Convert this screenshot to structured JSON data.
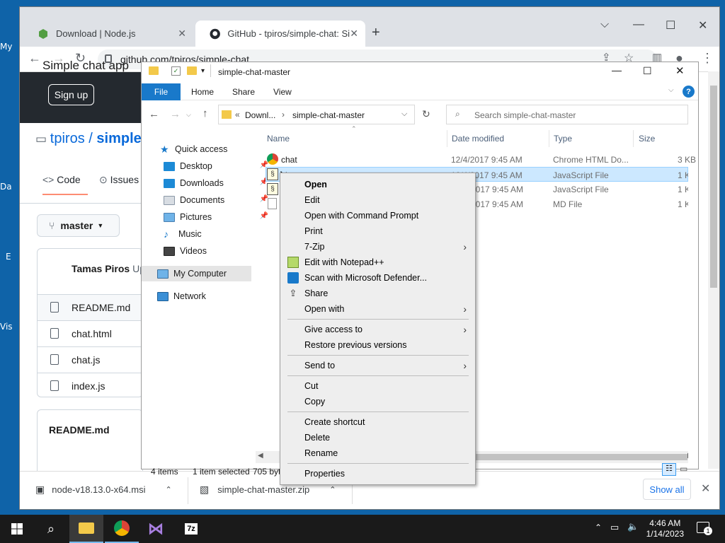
{
  "desktop": {
    "labels": [
      "My",
      "Da",
      "E",
      "Vis"
    ]
  },
  "chrome": {
    "tabs": [
      {
        "title": "Download | Node.js"
      },
      {
        "title": "GitHub - tpiros/simple-chat: Simp"
      }
    ],
    "new_tab": "+",
    "url": "github.com/tpiros/simple-chat"
  },
  "github": {
    "sign_up": "Sign up",
    "owner": "tpiros",
    "sep": "/",
    "repo": "simple",
    "tab_code": "Code",
    "tab_issues": "Issues",
    "branch": "master",
    "commit_author": "Tamas Piros",
    "commit_suffix": "Up",
    "files": [
      "README.md",
      "chat.html",
      "chat.js",
      "index.js"
    ],
    "readme_title": "README.md",
    "readme_body": "Simple chat app"
  },
  "explorer": {
    "title": "simple-chat-master",
    "ribbon": {
      "file": "File",
      "home": "Home",
      "share": "Share",
      "view": "View",
      "help": "?"
    },
    "address": {
      "prefix": "«",
      "crumb1": "Downl...",
      "crumb2": "simple-chat-master"
    },
    "search_placeholder": "Search simple-chat-master",
    "nav": {
      "quick_access": "Quick access",
      "items": [
        "Desktop",
        "Downloads",
        "Documents",
        "Pictures",
        "Music",
        "Videos"
      ],
      "my_computer": "My Computer",
      "network": "Network"
    },
    "columns": {
      "name": "Name",
      "date": "Date modified",
      "type": "Type",
      "size": "Size"
    },
    "rows": [
      {
        "name": "chat",
        "date": "12/4/2017 9:45 AM",
        "type": "Chrome HTML Do...",
        "size": "3 KB"
      },
      {
        "name": "chat",
        "date": "12/4/2017 9:45 AM",
        "type": "JavaScript File",
        "size": "1 KB"
      },
      {
        "name": "",
        "date": "2017 9:45 AM",
        "type": "JavaScript File",
        "size": "1 KB"
      },
      {
        "name": "",
        "date": "2017 9:45 AM",
        "type": "MD File",
        "size": "1 KB"
      }
    ],
    "status": {
      "items": "4 items",
      "selected": "1 item selected",
      "size": "705 byt"
    }
  },
  "context_menu": {
    "group1": [
      "Open",
      "Edit",
      "Open with Command Prompt",
      "Print",
      "7-Zip",
      "Edit with Notepad++",
      "Scan with Microsoft Defender...",
      "Share",
      "Open with"
    ],
    "group2": [
      "Give access to",
      "Restore previous versions"
    ],
    "group3": [
      "Send to"
    ],
    "group4": [
      "Cut",
      "Copy"
    ],
    "group5": [
      "Create shortcut",
      "Delete",
      "Rename"
    ],
    "group6": [
      "Properties"
    ]
  },
  "downloads": {
    "items": [
      {
        "name": "node-v18.13.0-x64.msi"
      },
      {
        "name": "simple-chat-master.zip"
      }
    ],
    "show_all": "Show all"
  },
  "taskbar": {
    "time": "4:46 AM",
    "date": "1/14/2023",
    "notifications": "1"
  }
}
